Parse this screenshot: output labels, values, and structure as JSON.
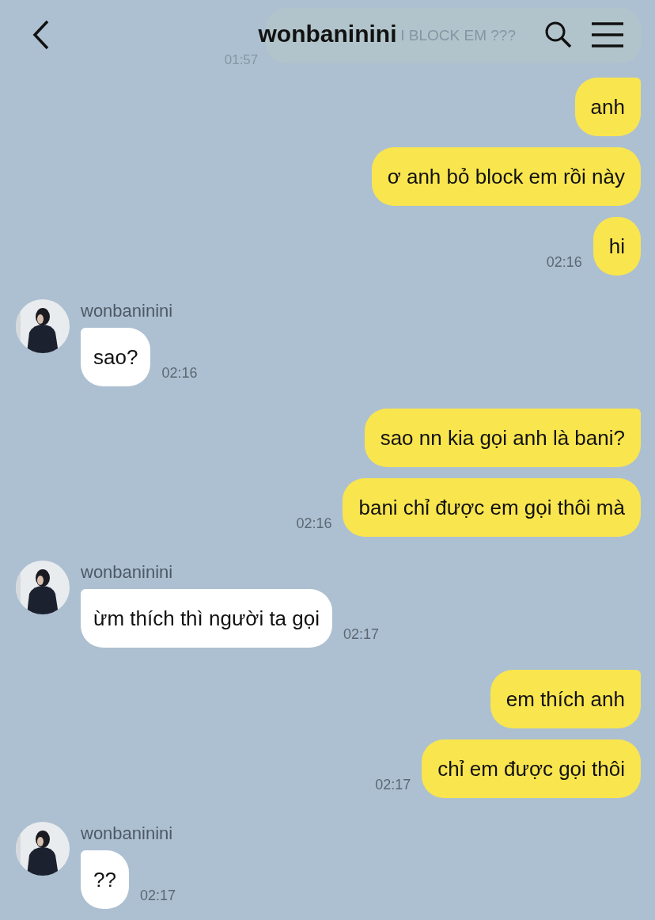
{
  "header": {
    "title": "wonbaninini"
  },
  "faded_message": {
    "text": "I BLOCK EM ???",
    "time": "01:57"
  },
  "groups": [
    {
      "kind": "sent",
      "messages": [
        {
          "text": "anh"
        },
        {
          "text": "ơ anh bỏ block em rồi này"
        },
        {
          "text": "hi",
          "time": "02:16"
        }
      ]
    },
    {
      "kind": "received",
      "sender": "wonbaninini",
      "messages": [
        {
          "text": "sao?",
          "time": "02:16"
        }
      ]
    },
    {
      "kind": "sent",
      "messages": [
        {
          "text": "sao nn kia gọi anh là bani?"
        },
        {
          "text": "bani chỉ được em gọi thôi mà",
          "time": "02:16"
        }
      ]
    },
    {
      "kind": "received",
      "sender": "wonbaninini",
      "messages": [
        {
          "text": "ừm thích thì người ta gọi",
          "time": "02:17"
        }
      ]
    },
    {
      "kind": "sent",
      "messages": [
        {
          "text": "em thích anh"
        },
        {
          "text": "chỉ em được gọi thôi",
          "time": "02:17"
        }
      ]
    },
    {
      "kind": "received",
      "sender": "wonbaninini",
      "messages": [
        {
          "text": "??",
          "time": "02:17"
        }
      ]
    }
  ]
}
